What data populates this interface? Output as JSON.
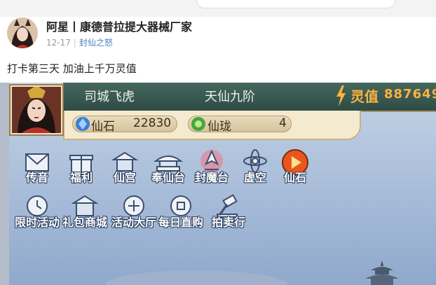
{
  "post": {
    "author": "阿星丨康德普拉提大器械厂家",
    "date": "12-17",
    "topic": "封仙之怒",
    "text": "打卡第三天 加油上千万灵值"
  },
  "game": {
    "player_name": "司城飞虎",
    "realm": "天仙九阶",
    "power_label": "灵值",
    "power_value": "887649",
    "currencies": [
      {
        "icon": "crystal-icon",
        "label": "仙石",
        "value": "22830"
      },
      {
        "icon": "jade-icon",
        "label": "仙珑",
        "value": "4"
      }
    ],
    "menu_row1": [
      {
        "icon": "envelope-icon",
        "label": "传音"
      },
      {
        "icon": "gift-box-icon",
        "label": "福利"
      },
      {
        "icon": "palace-icon",
        "label": "仙宫"
      },
      {
        "icon": "altar-icon",
        "label": "奉仙台"
      },
      {
        "icon": "demon-seal-icon",
        "label": "封魔台"
      },
      {
        "icon": "atom-icon",
        "label": "虚空"
      },
      {
        "icon": "play-icon",
        "label": "仙石"
      }
    ],
    "menu_row2": [
      {
        "icon": "timed-event-icon",
        "label": "限时活动"
      },
      {
        "icon": "gift-shop-icon",
        "label": "礼包商城"
      },
      {
        "icon": "event-hall-icon",
        "label": "活动大厅"
      },
      {
        "icon": "daily-purchase-icon",
        "label": "每日直购"
      },
      {
        "icon": "auction-gavel-icon",
        "label": "拍卖行"
      }
    ]
  }
}
